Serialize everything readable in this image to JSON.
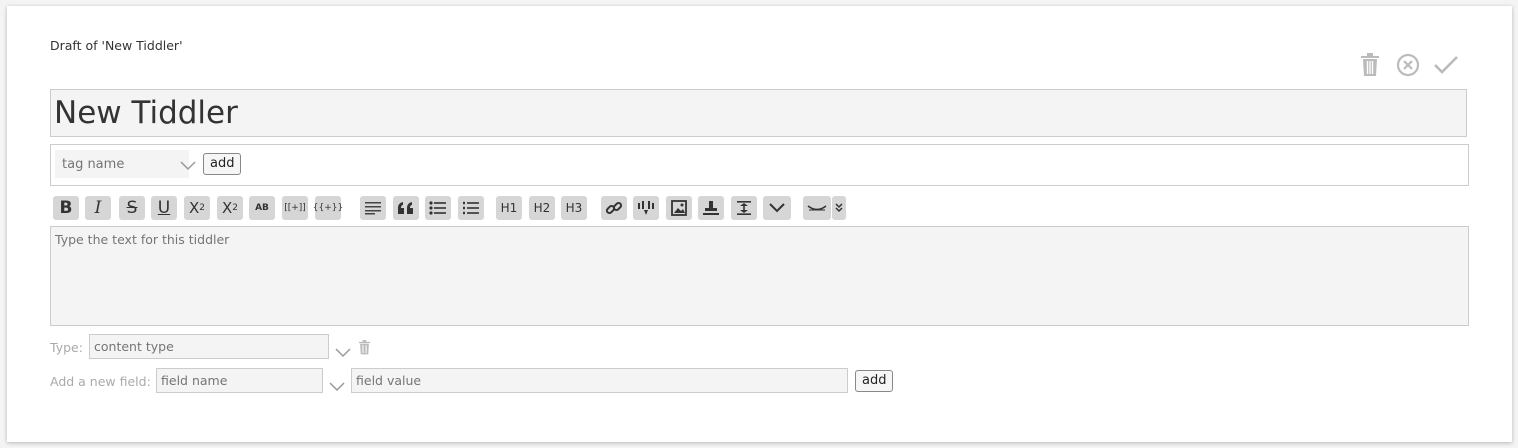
{
  "header": {
    "draft_title": "Draft of 'New Tiddler'",
    "icons": [
      "delete-icon",
      "cancel-icon",
      "done-icon"
    ]
  },
  "title_field": {
    "value": "New Tiddler"
  },
  "tags": {
    "placeholder": "tag name",
    "add_label": "add"
  },
  "toolbar": {
    "bold": "B",
    "italic": "I",
    "strike": "S",
    "underline": "U",
    "h1": "H1",
    "h2": "H2",
    "h3": "H3",
    "smallcaps": "AB",
    "wikilink": "[[+]]",
    "transclude": "{{+}}"
  },
  "editor": {
    "placeholder": "Type the text for this tiddler"
  },
  "type_row": {
    "label": "Type:",
    "placeholder": "content type"
  },
  "field_row": {
    "label": "Add a new field:",
    "name_placeholder": "field name",
    "value_placeholder": "field value",
    "add_label": "add"
  }
}
